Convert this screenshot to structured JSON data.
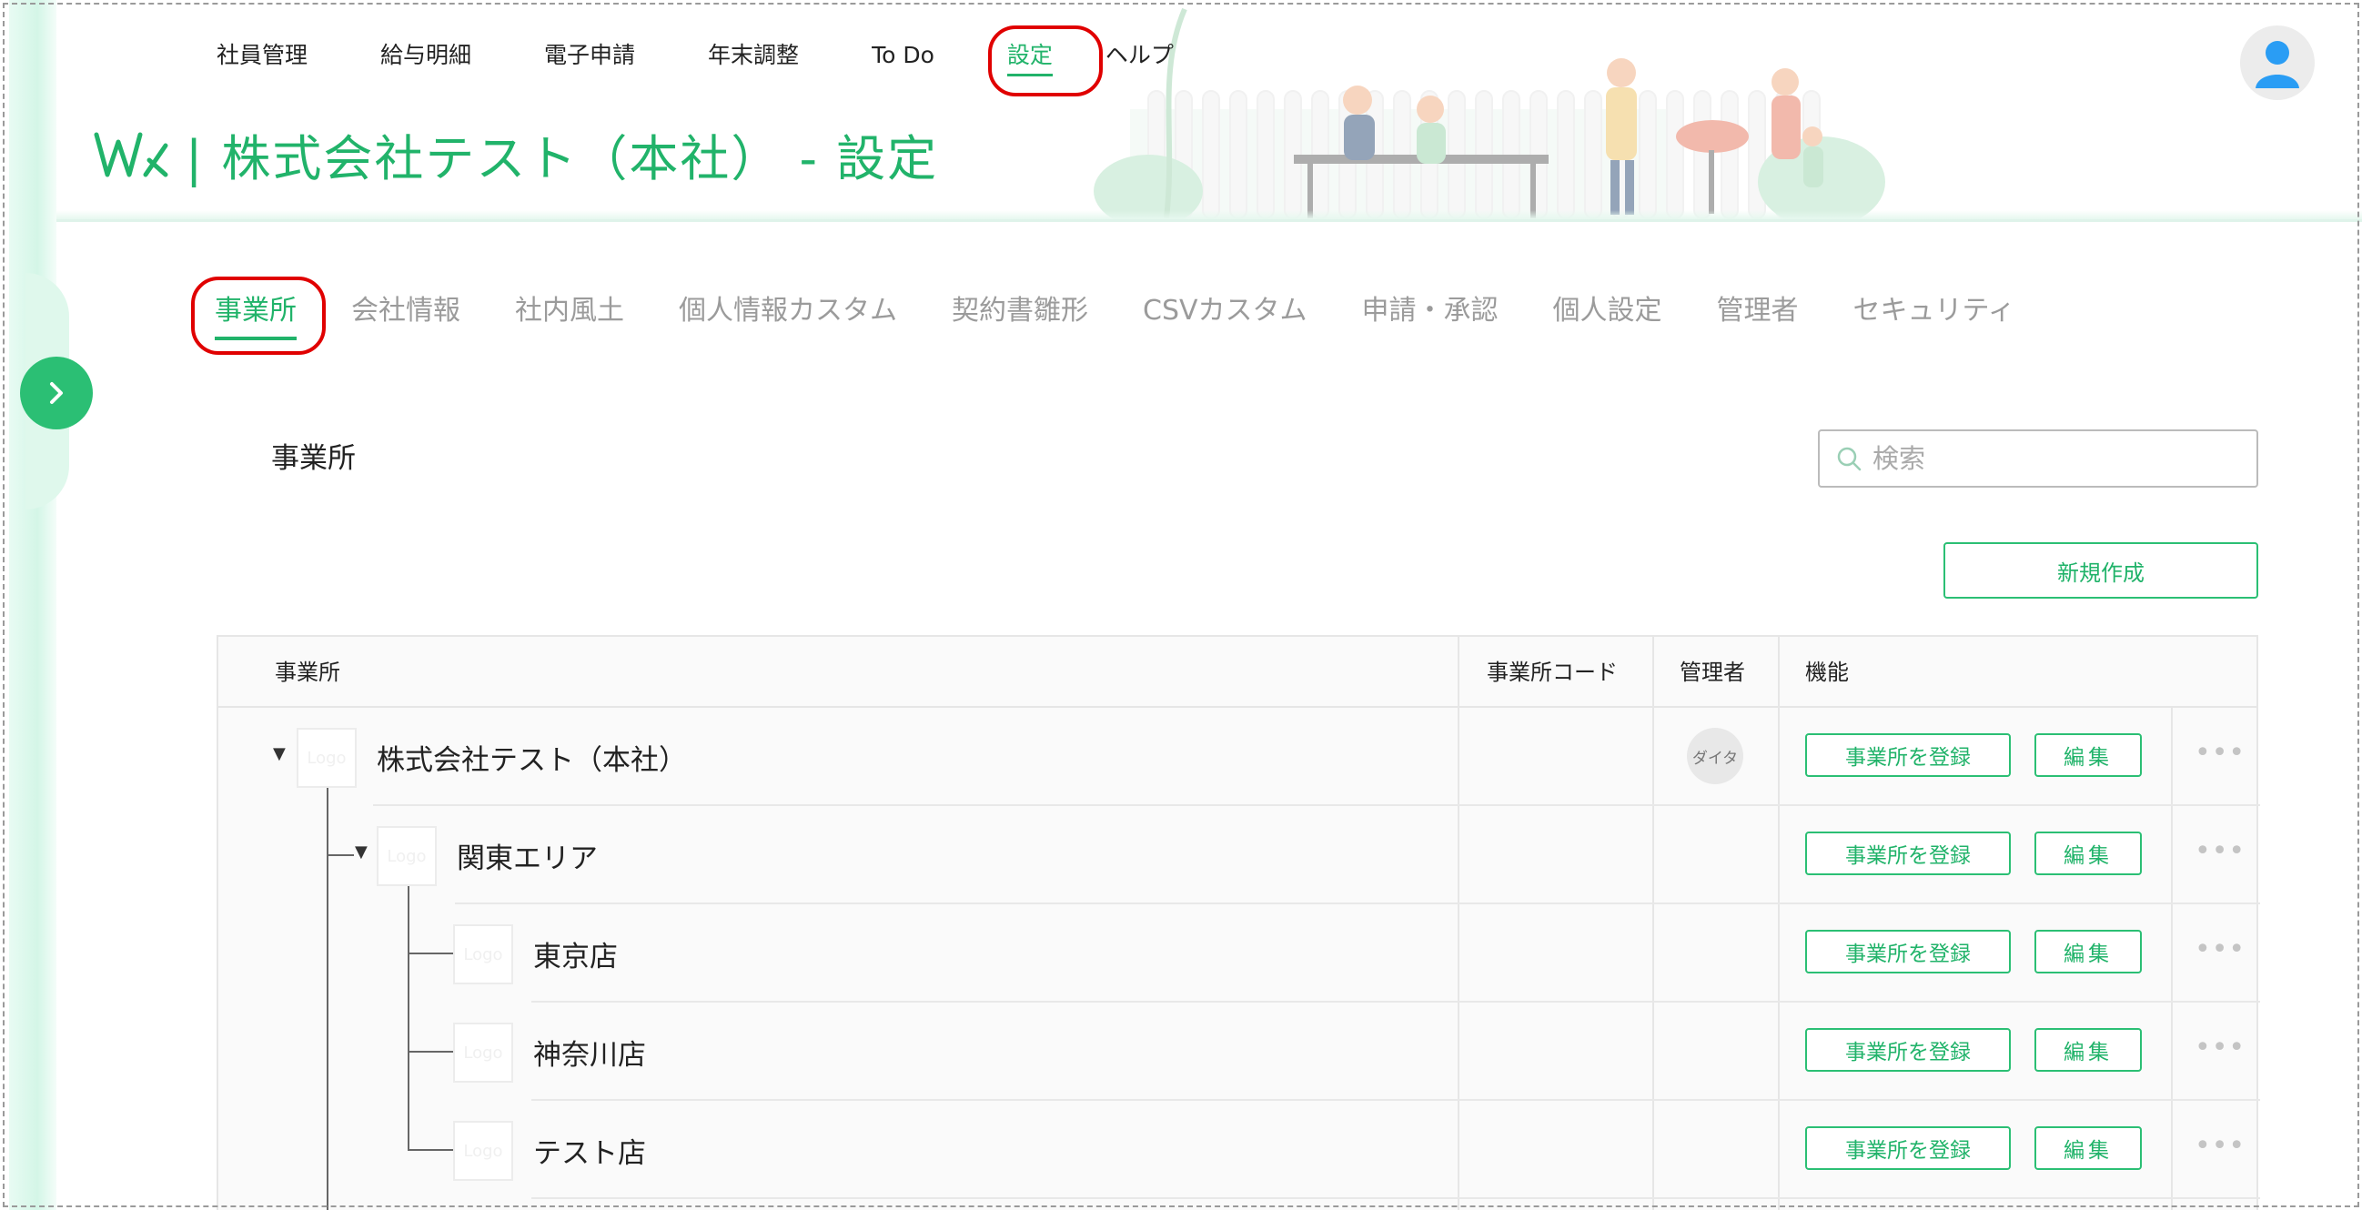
{
  "topnav": {
    "items": [
      {
        "label": "社員管理"
      },
      {
        "label": "給与明細"
      },
      {
        "label": "電子申請"
      },
      {
        "label": "年末調整"
      },
      {
        "label": "To Do"
      },
      {
        "label": "設定"
      },
      {
        "label": "ヘルプ"
      }
    ],
    "active": "設定"
  },
  "brand": {
    "logo_icon": "wk-logo",
    "title": "| 株式会社テスト（本社） - 設定"
  },
  "avatar": {
    "icon": "user-icon"
  },
  "subtabs": {
    "items": [
      {
        "label": "事業所"
      },
      {
        "label": "会社情報"
      },
      {
        "label": "社内風土"
      },
      {
        "label": "個人情報カスタム"
      },
      {
        "label": "契約書雛形"
      },
      {
        "label": "CSVカスタム"
      },
      {
        "label": "申請・承認"
      },
      {
        "label": "個人設定"
      },
      {
        "label": "管理者"
      },
      {
        "label": "セキュリティ"
      }
    ],
    "active": "事業所"
  },
  "section": {
    "title": "事業所"
  },
  "search": {
    "placeholder": "検索",
    "icon": "search-icon"
  },
  "new_button": {
    "label": "新規作成"
  },
  "table": {
    "headers": {
      "office": "事業所",
      "code": "事業所コード",
      "admin": "管理者",
      "functions": "機能"
    },
    "rows": [
      {
        "name": "株式会社テスト（本社）",
        "logo": "Logo",
        "admin": "ダイタ",
        "register": "事業所を登録",
        "edit": "編集",
        "more": "•••"
      },
      {
        "name": "関東エリア",
        "logo": "Logo",
        "admin": "",
        "register": "事業所を登録",
        "edit": "編集",
        "more": "•••"
      },
      {
        "name": "東京店",
        "logo": "Logo",
        "admin": "",
        "register": "事業所を登録",
        "edit": "編集",
        "more": "•••"
      },
      {
        "name": "神奈川店",
        "logo": "Logo",
        "admin": "",
        "register": "事業所を登録",
        "edit": "編集",
        "more": "•••"
      },
      {
        "name": "テスト店",
        "logo": "Logo",
        "admin": "",
        "register": "事業所を登録",
        "edit": "編集",
        "more": "•••"
      }
    ]
  },
  "colors": {
    "accent": "#21b36a",
    "highlight_ring": "#e00000"
  }
}
